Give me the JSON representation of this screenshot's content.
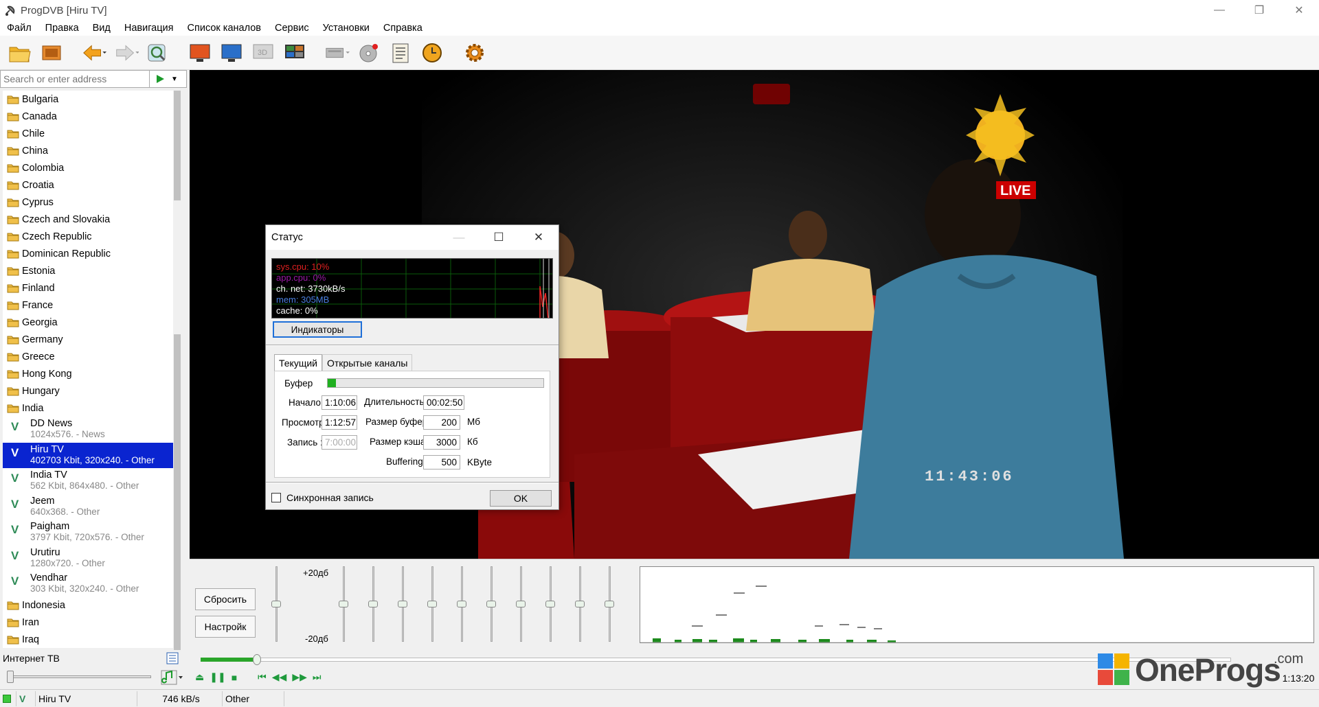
{
  "window": {
    "title": "ProgDVB [Hiru TV]",
    "minimize": "—",
    "restore": "❐",
    "close": "✕"
  },
  "menu": [
    "Файл",
    "Правка",
    "Вид",
    "Навигация",
    "Список каналов",
    "Сервис",
    "Установки",
    "Справка"
  ],
  "toolbar": {
    "icons": [
      "open-folder-icon",
      "recordings-icon",
      "back-arrow-icon",
      "forward-arrow-icon",
      "search-channel-icon",
      "display-icon",
      "monitor-icon",
      "3d-icon",
      "multi-view-icon",
      "device-icon",
      "disc-icon",
      "notes-icon",
      "scheduler-clock-icon",
      "settings-gear-icon"
    ]
  },
  "address": {
    "placeholder": "Search or enter address"
  },
  "tree": {
    "countries_top": [
      "Bulgaria",
      "Canada",
      "Chile",
      "China",
      "Colombia",
      "Croatia",
      "Cyprus",
      "Czech and Slovakia",
      "Czech Republic",
      "Dominican Republic",
      "Estonia",
      "Finland",
      "France",
      "Georgia",
      "Germany",
      "Greece",
      "Hong Kong",
      "Hungary",
      "India"
    ],
    "channels": [
      {
        "name": "DD News",
        "sub": "1024x576. - News",
        "selected": false
      },
      {
        "name": "Hiru TV",
        "sub": "402703 Kbit, 320x240. - Other",
        "selected": true
      },
      {
        "name": "India TV",
        "sub": "562 Kbit, 864x480. - Other",
        "selected": false
      },
      {
        "name": "Jeem",
        "sub": "640x368. - Other",
        "selected": false
      },
      {
        "name": "Paigham",
        "sub": "3797 Kbit, 720x576. - Other",
        "selected": false
      },
      {
        "name": "Urutiru",
        "sub": "1280x720. - Other",
        "selected": false
      },
      {
        "name": "Vendhar",
        "sub": "303 Kbit, 320x240. - Other",
        "selected": false
      }
    ],
    "countries_bottom": [
      "Indonesia",
      "Iran",
      "Iraq"
    ]
  },
  "left_bottom": {
    "group": "Интернет ТВ"
  },
  "video": {
    "timestamp": "11:43:06",
    "badge": "LIVE"
  },
  "equalizer": {
    "reset": "Сбросить",
    "setup": "Настройк",
    "scale_top": "+20дб",
    "scale_bottom": "-20дб"
  },
  "transport": {
    "time": "1:13:20",
    "brand": "OneProgs",
    "brand_suffix": ".com"
  },
  "statusbar": {
    "channel": "Hiru TV",
    "rate": "746 kB/s",
    "category": "Other"
  },
  "dialog": {
    "title": "Статус",
    "monitor": {
      "sys_cpu": "sys.cpu: 10%",
      "app_cpu": "app.cpu: 0%",
      "net": "ch. net: 3730kB/s",
      "mem": "mem: 305MB",
      "cache": "cache: 0%"
    },
    "indicators": "Индикаторы",
    "tabs": [
      "Текущий",
      "Открытые каналы"
    ],
    "labels": {
      "buffer": "Буфер",
      "start": "Начало :",
      "view": "Просмотр",
      "record": "Запись :",
      "duration": "Длительность :",
      "buffer_size": "Размер буфера",
      "cache_size": "Размер кэша :",
      "buffering": "Buffering :"
    },
    "values": {
      "start": "1:10:06",
      "view": "1:12:57",
      "record": "7:00:00",
      "duration": "00:02:50",
      "buffer_size": "200",
      "cache_size": "3000",
      "buffering": "500"
    },
    "units": {
      "buffer_size": "Мб",
      "cache_size": "Кб",
      "buffering": "KByte"
    },
    "sync_record": "Синхронная запись",
    "ok": "OK"
  }
}
